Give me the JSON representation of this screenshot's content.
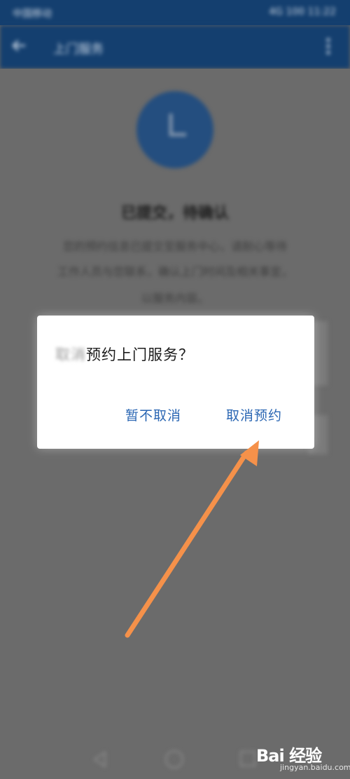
{
  "status_bar": {
    "left_text": "中国移动",
    "right_text": "4G 100 11:22"
  },
  "app_bar": {
    "title": "上门服务"
  },
  "background": {
    "heading": "已提交，待确认",
    "line1": "您的预约信息已提交至服务中心，请耐心等待",
    "line2": "工作人员与您联系，确认上门时间及相关事宜，",
    "line3": "以服务内容。"
  },
  "dialog": {
    "title_faded": "取消",
    "title_main": "预约上门服务？",
    "cancel_label": "暂不取消",
    "confirm_label": "取消预约"
  },
  "watermark": {
    "text": "Bai 经验",
    "sub": "jingyan.baidu.com"
  },
  "colors": {
    "app_bar": "#143f6f",
    "accent": "#2a66b3",
    "arrow": "#f5914a",
    "overlay": "#6b6b6b"
  }
}
